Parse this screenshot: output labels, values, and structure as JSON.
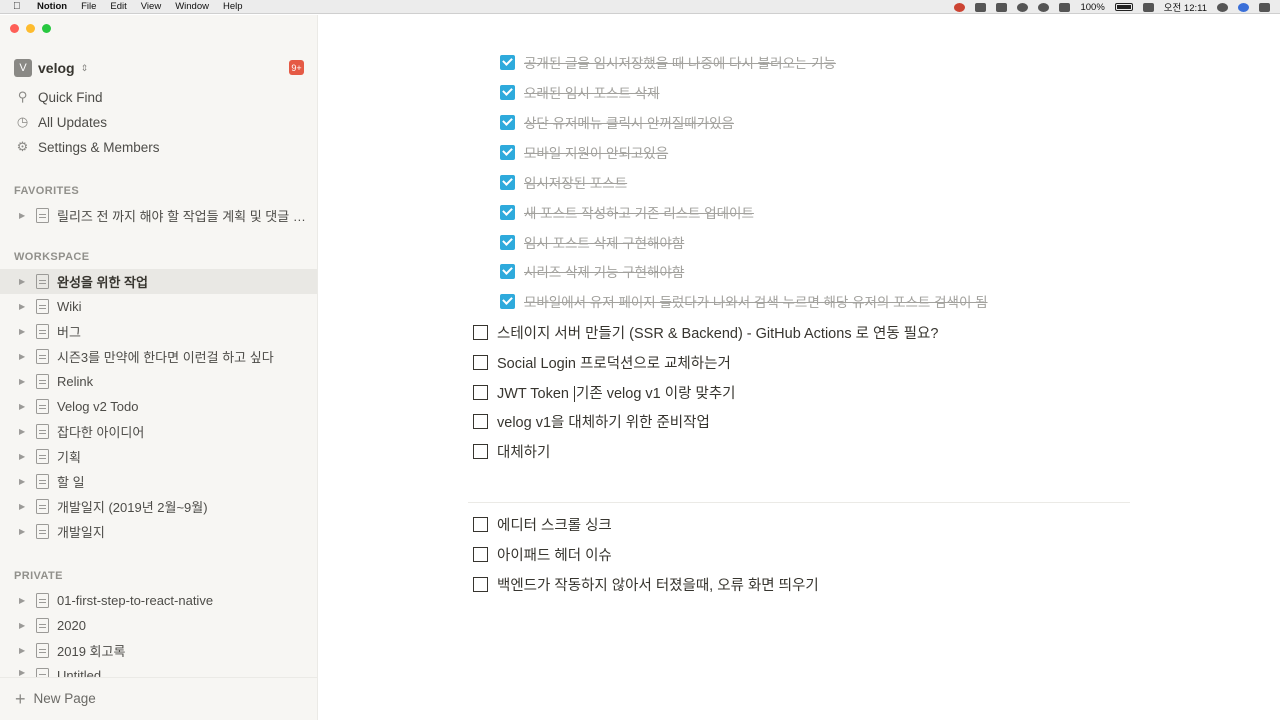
{
  "menubar": {
    "app_name": "Notion",
    "menus": [
      "File",
      "Edit",
      "View",
      "Window",
      "Help"
    ],
    "battery": "100%",
    "clock": "오전 12:11"
  },
  "sidebar": {
    "workspace_initial": "V",
    "workspace_name": "velog",
    "notification_badge": "9+",
    "actions": {
      "quick_find": "Quick Find",
      "all_updates": "All Updates",
      "settings": "Settings & Members"
    },
    "favorites_label": "FAVORITES",
    "favorites": [
      {
        "label": "릴리즈 전 까지 해야 할 작업들 계획 및 댓글 디..."
      }
    ],
    "workspace_label": "WORKSPACE",
    "workspace_pages": [
      {
        "label": "완성을 위한 작업",
        "active": true
      },
      {
        "label": "Wiki"
      },
      {
        "label": "버그"
      },
      {
        "label": "시즌3를 만약에 한다면 이런걸 하고 싶다"
      },
      {
        "label": "Relink"
      },
      {
        "label": "Velog v2 Todo"
      },
      {
        "label": "잡다한 아이디어"
      },
      {
        "label": "기획"
      },
      {
        "label": "할 일"
      },
      {
        "label": "개발일지 (2019년 2월~9월)"
      },
      {
        "label": "개발일지"
      }
    ],
    "private_label": "PRIVATE",
    "private_pages": [
      {
        "label": "01-first-step-to-react-native"
      },
      {
        "label": "2020"
      },
      {
        "label": "2019 회고록"
      },
      {
        "label": "Untitled"
      }
    ],
    "new_page": "New Page"
  },
  "content": {
    "done_todos": [
      "공개된 글을 임시저장했을 때 나중에 다시 불러오는 기능",
      "오래된 임시 포스트 삭제",
      "상단 유저메뉴 클릭시 안꺼질때가있음",
      "모바일 지원이 안되고있음",
      "임시저장된 포스트",
      "새 포스트 작성하고 기존 리스트 업데이트",
      "임시 포스트 삭제 구현해야함",
      "시리즈 삭제 기능 구현해야함",
      "모바일에서 유저 페이지 들렀다가 나와서 검색 누르면 해당 유저의 포스트 검색이 됨"
    ],
    "open_todos": [
      "스테이지 서버 만들기 (SSR & Backend) - GitHub Actions 로 연동 필요?",
      "Social Login 프로덕션으로 교체하는거",
      "JWT Token",
      "velog v1을 대체하기 위한 준비작업",
      "대체하기"
    ],
    "jwt_rest": "기존 velog v1 이랑 맞추기",
    "bottom_todos": [
      "에디터 스크롤 싱크",
      "아이패드 헤더 이슈",
      "백엔드가 작동하지 않아서 터졌을때, 오류 화면 띄우기"
    ]
  },
  "colors": {
    "accent_checkbox": "#2eaadc",
    "sidebar_bg": "#f7f6f3",
    "badge": "#e55a45"
  }
}
